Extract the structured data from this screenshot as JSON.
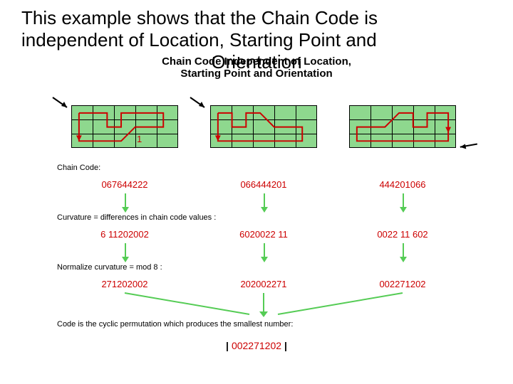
{
  "title": {
    "line1": "This example shows that the Chain Code is",
    "line2": "independent of Location, Starting Point and",
    "line3": "Orientation"
  },
  "inner_title": {
    "l1": "Chain Code Independent of Location,",
    "l2": "Starting Point and Orientation"
  },
  "grid1": {
    "dir_label": "1"
  },
  "sections": {
    "chain_code_hdr": "Chain Code:",
    "chain_codes": [
      "067644222",
      "066444201",
      "444201066"
    ],
    "curvature_hdr": "Curvature  =  differences in chain code values :",
    "curvatures": [
      "6 11202002",
      "6020022 11",
      "0022 11 602"
    ],
    "normalize_hdr": "Normalize curvature  =  mod 8 :",
    "normalized": [
      "271202002",
      "202002271",
      "002271202"
    ],
    "cyclic_hdr": "Code is the cyclic permutation which produces the smallest number:",
    "result": "002271202"
  }
}
